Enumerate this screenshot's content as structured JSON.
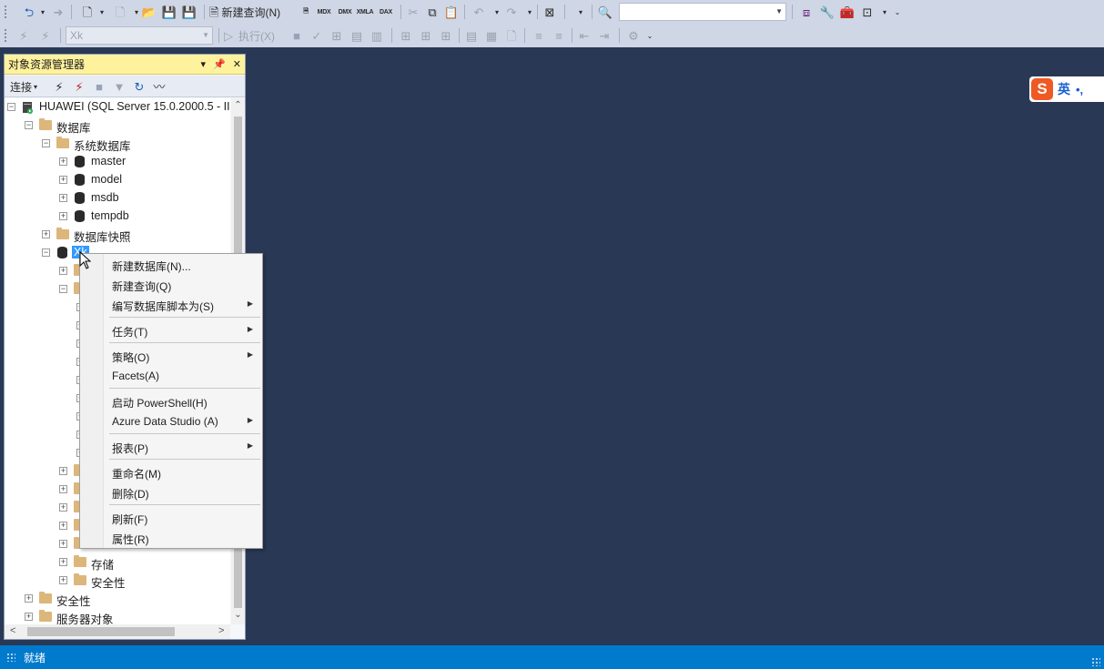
{
  "toolbar": {
    "new_query_label": "新建查询(N)",
    "execute_label": "执行(X)",
    "database_combo_value": "Xk",
    "query_icons": [
      "MDX",
      "DMX",
      "XMLA",
      "DAX"
    ]
  },
  "object_explorer": {
    "title": "对象资源管理器",
    "connect_label": "连接",
    "tree": {
      "server": "HUAWEI (SQL Server 15.0.2000.5 - II",
      "databases": "数据库",
      "system_databases": "系统数据库",
      "system_db_items": [
        "master",
        "model",
        "msdb",
        "tempdb"
      ],
      "snapshots": "数据库快照",
      "selected_db": "Xk",
      "storage": "存储",
      "db_security": "安全性",
      "security": "安全性",
      "server_objects": "服务器对象"
    }
  },
  "context_menu": {
    "items": [
      {
        "label": "新建数据库(N)...",
        "submenu": false
      },
      {
        "label": "新建查询(Q)",
        "submenu": false
      },
      {
        "label": "编写数据库脚本为(S)",
        "submenu": true
      },
      {
        "label": "任务(T)",
        "submenu": true
      },
      {
        "label": "策略(O)",
        "submenu": true
      },
      {
        "label": "Facets(A)",
        "submenu": false
      },
      {
        "label": "启动 PowerShell(H)",
        "submenu": false
      },
      {
        "label": "Azure Data Studio (A)",
        "submenu": true
      },
      {
        "label": "报表(P)",
        "submenu": true
      },
      {
        "label": "重命名(M)",
        "submenu": false
      },
      {
        "label": "删除(D)",
        "submenu": false
      },
      {
        "label": "刷新(F)",
        "submenu": false
      },
      {
        "label": "属性(R)",
        "submenu": false
      }
    ]
  },
  "ime": {
    "logo": "S",
    "mode": "英",
    "punct": "•,"
  },
  "status": {
    "text": "就绪"
  },
  "colors": {
    "workspace": "#293854",
    "statusbar": "#007acc",
    "oe_title": "#fff29d",
    "selection": "#3399ff"
  }
}
